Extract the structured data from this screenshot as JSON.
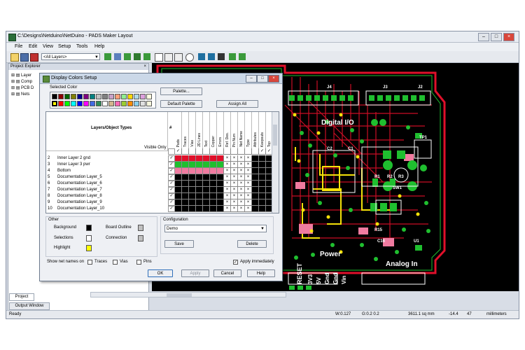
{
  "window": {
    "title": "C:\\Designs\\Netduino\\NetDuino - PADS Maker Layout",
    "minimize": "–",
    "maximize": "□",
    "close": "×"
  },
  "menu": [
    "File",
    "Edit",
    "View",
    "Setup",
    "Tools",
    "Help"
  ],
  "toolbar": {
    "layer_select": "<All Layers>"
  },
  "explorer": {
    "title": "Project Explorer",
    "close": "×",
    "items": [
      "Layer",
      "Comp",
      "PCB D",
      "Nets"
    ],
    "tab_project": "Project",
    "tab_output": "Output Window"
  },
  "dialog": {
    "title": "Display Colors Setup",
    "selected_color_label": "Selected Color",
    "palette_button": "Palette...",
    "default_palette_button": "Default Palette",
    "assign_all_button": "Assign All",
    "grid_header": "Layers/Object Types",
    "hash_header": "#",
    "visible_only": "Visible Only",
    "columns": [
      "Pads",
      "Traces",
      "Vias",
      "2D Lines",
      "Text",
      "Copper",
      "Errors",
      "Ref. Des.",
      "Pin Num",
      "Net Name",
      "Type",
      "Attributes",
      "Keepouts",
      "Top",
      "Bottom"
    ],
    "rows": [
      {
        "num": "2",
        "name": "Inner Layer 2 gnd"
      },
      {
        "num": "3",
        "name": "Inner Layer 3 pwr"
      },
      {
        "num": "4",
        "name": "Bottom"
      },
      {
        "num": "5",
        "name": "Documentation Layer_5"
      },
      {
        "num": "6",
        "name": "Documentation Layer_6"
      },
      {
        "num": "7",
        "name": "Documentation Layer_7"
      },
      {
        "num": "8",
        "name": "Documentation Layer_8"
      },
      {
        "num": "9",
        "name": "Documentation Layer_9"
      },
      {
        "num": "10",
        "name": "Documentation Layer_10"
      }
    ],
    "other_label": "Other",
    "background": "Background",
    "board_outline": "Board Outline",
    "selections": "Selections",
    "connection": "Connection",
    "highlight": "Highlight",
    "configuration_label": "Configuration",
    "configuration_value": "Demo",
    "save_button": "Save",
    "delete_button": "Delete",
    "show_net_names_label": "Show net names on",
    "traces": "Traces",
    "vias": "Vias",
    "pins": "Pins",
    "apply_immediately": "Apply immediately",
    "ok_button": "OK",
    "apply_button": "Apply",
    "cancel_button": "Cancel",
    "help_button": "Help",
    "check": "✓",
    "cross": "×"
  },
  "canvas": {
    "labels": [
      "Digital I/O",
      "Power",
      "Analog In",
      "RESET",
      "3V3",
      "5V",
      "Gnd",
      "Gnd",
      "Vin",
      "J4",
      "J3",
      "J2",
      "TP1",
      "R1",
      "R2",
      "R3",
      "R15",
      "C16",
      "U1",
      "SW1",
      "C2",
      "C1"
    ]
  },
  "status": {
    "left": "Ready",
    "w": "W:0.127",
    "g": "G:0.2 0.2",
    "area": "3611.1 sq mm",
    "x": "-14.4",
    "y": "47",
    "units": "millimeters"
  },
  "colors": {
    "board_red": "#e0102a",
    "copper_green": "#1fbf2f",
    "silk_white": "#ffffff",
    "yellow": "#f5e20a",
    "pink": "#f07ba0"
  }
}
